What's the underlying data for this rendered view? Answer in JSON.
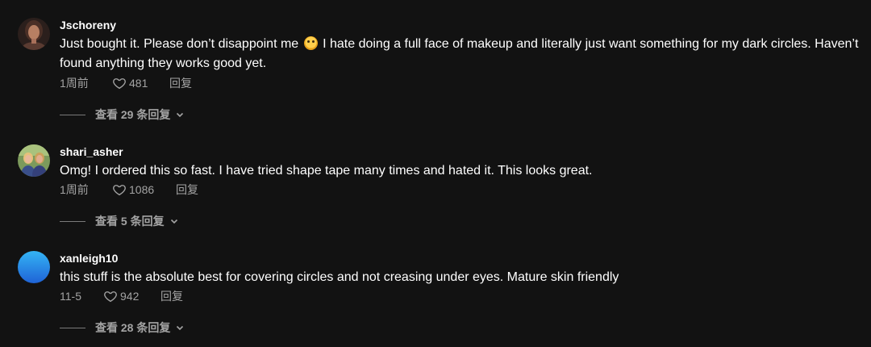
{
  "comments": [
    {
      "username": "Jschoreny",
      "text_before_emoji": "Just bought it. Please don’t disappoint me ",
      "emoji": "crying-face-emoji",
      "text_after_emoji": " I hate doing a full face of makeup and literally just want something for my dark circles. Haven’t found anything they works good yet.",
      "time": "1周前",
      "likes": "481",
      "reply_label": "回复",
      "view_replies": "查看 29 条回复"
    },
    {
      "username": "shari_asher",
      "text": "Omg! I ordered this so fast. I have tried shape tape many times and hated it. This looks great.",
      "time": "1周前",
      "likes": "1086",
      "reply_label": "回复",
      "view_replies": "查看 5 条回复"
    },
    {
      "username": "xanleigh10",
      "text": "this stuff is the absolute best for covering circles and not creasing under eyes. Mature skin friendly",
      "time": "11-5",
      "likes": "942",
      "reply_label": "回复",
      "view_replies": "查看 28 条回复"
    }
  ],
  "colors": {
    "background": "#121212",
    "text_primary": "#ffffff",
    "text_secondary": "#a3a3a3",
    "avatar3_gradient_top": "#34b4f5",
    "avatar3_gradient_bottom": "#1f63d6"
  }
}
